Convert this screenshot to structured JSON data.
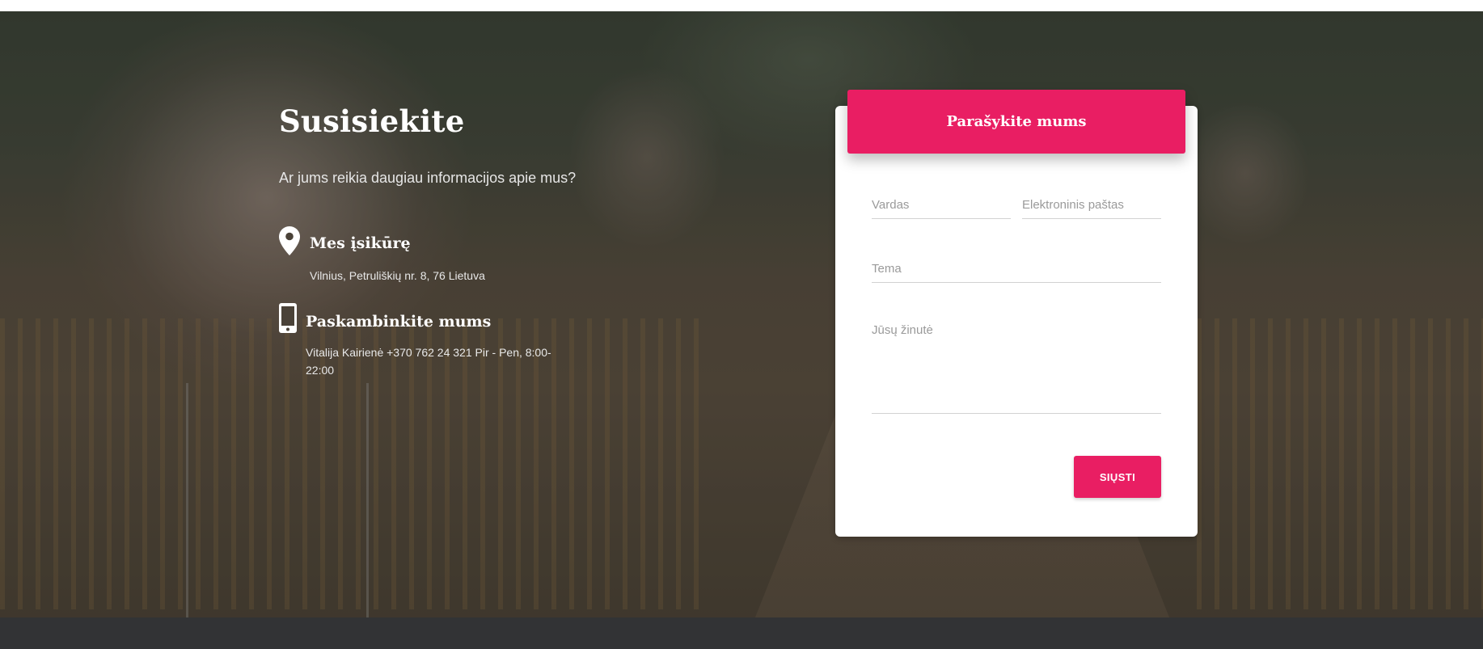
{
  "contact": {
    "title": "Susisiekite",
    "subtitle": "Ar jums reikia daugiau informacijos apie mus?",
    "location": {
      "icon": "map-pin-icon",
      "heading": "Mes įsikūrę",
      "text": "Vilnius, Petruliškių nr. 8, 76 Lietuva"
    },
    "phone": {
      "icon": "smartphone-icon",
      "heading": "Paskambinkite mums",
      "text": "Vitalija Kairienė +370 762 24 321  Pir - Pen, 8:00-22:00"
    }
  },
  "form": {
    "header": "Parašykite mums",
    "name_placeholder": "Vardas",
    "email_placeholder": "Elektroninis paštas",
    "subject_placeholder": "Tema",
    "message_placeholder": "Jūsų žinutė",
    "submit_label": "SIŲSTI"
  },
  "colors": {
    "accent": "#e91e63",
    "footer": "#323335"
  }
}
